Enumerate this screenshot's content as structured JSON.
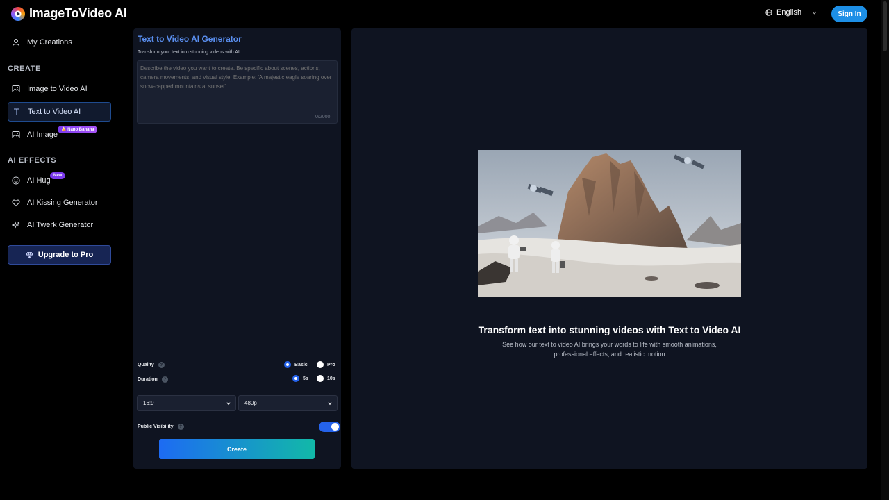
{
  "header": {
    "brand": "ImageToVideo AI",
    "language": "English",
    "sign_in": "Sign In"
  },
  "sidebar": {
    "my_creations": "My Creations",
    "section_create": "CREATE",
    "create_items": [
      {
        "label": "Image to Video AI",
        "icon": "image-icon"
      },
      {
        "label": "Text to Video AI",
        "icon": "text-icon",
        "active": true
      },
      {
        "label": "AI Image",
        "icon": "image-icon",
        "badge": "🍌 Nano Banana"
      }
    ],
    "section_effects": "AI EFFECTS",
    "effect_items": [
      {
        "label": "AI Hug",
        "icon": "smile-icon",
        "badge": "New"
      },
      {
        "label": "AI Kissing Generator",
        "icon": "heart-icon"
      },
      {
        "label": "AI Twerk Generator",
        "icon": "sparkles-icon"
      }
    ],
    "upgrade": "Upgrade to Pro"
  },
  "form": {
    "title": "Text to Video AI Generator",
    "subtitle": "Transform your text into stunning videos with AI",
    "prompt_placeholder": "Describe the video you want to create. Be specific about scenes, actions, camera movements, and visual style. Example: 'A majestic eagle soaring over snow-capped mountains at sunset'",
    "char_count": "0/2000",
    "quality_label": "Quality",
    "quality_options": [
      "Basic",
      "Pro"
    ],
    "quality_selected": "Basic",
    "duration_label": "Duration",
    "duration_options": [
      "5s",
      "10s"
    ],
    "duration_selected": "5s",
    "aspect_ratio": "16:9",
    "resolution": "480p",
    "visibility_label": "Public Visibility",
    "visibility_on": true,
    "create_button": "Create"
  },
  "preview": {
    "title": "Transform text into stunning videos with Text to Video AI",
    "description": "See how our text to video AI brings your words to life with smooth animations, professional effects, and realistic motion"
  },
  "colors": {
    "accent": "#2563eb",
    "title_blue": "#5a8ff0",
    "panel_bg": "#0f1421",
    "badge_purple": "#7c3aed"
  }
}
